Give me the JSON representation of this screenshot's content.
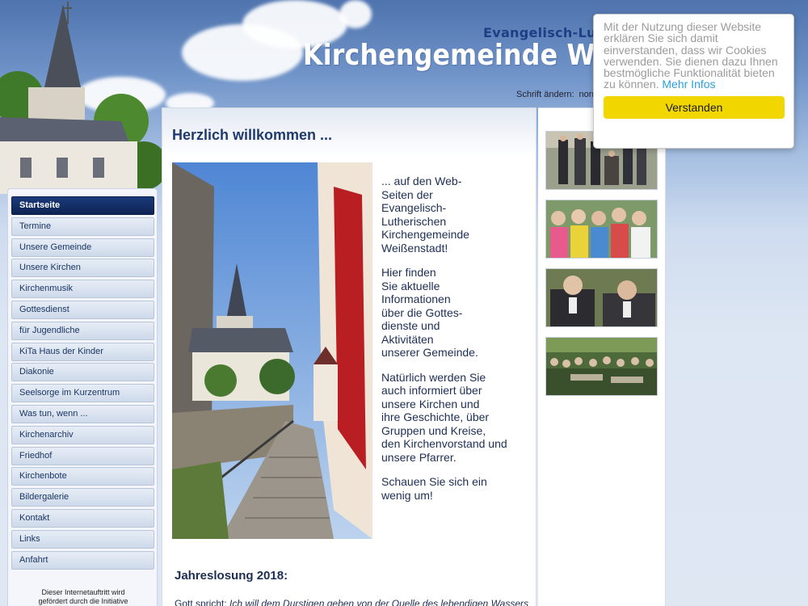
{
  "header": {
    "subtitle": "Evangelisch-Luthe",
    "title": "Kirchengemeinde Weißenst",
    "font_switch": {
      "label": "Schrift ändern:",
      "option": "norm"
    }
  },
  "nav": {
    "items": [
      "Startseite",
      "Termine",
      "Unsere Gemeinde",
      "Unsere Kirchen",
      "Kirchenmusik",
      "Gottesdienst",
      "für Jugendliche",
      "KiTa Haus der Kinder",
      "Diakonie",
      "Seelsorge im Kurzentrum",
      "Was tun, wenn ...",
      "Kirchenarchiv",
      "Friedhof",
      "Kirchenbote",
      "Bildergalerie",
      "Kontakt",
      "Links",
      "Anfahrt"
    ],
    "active": "Startseite",
    "note_line1": "Dieser Internetauftritt wird",
    "note_line2": "gefördert durch die Initiative"
  },
  "main": {
    "title": "Herzlich willkommen ...",
    "paragraphs": [
      "... auf den Web-\nSeiten der\nEvangelisch-\nLutherischen\nKirchengemeinde\nWeißenstadt!",
      "Hier finden\nSie aktuelle\nInformationen\nüber die Gottes-\ndienste und\nAktivitäten\nunserer Gemeinde.",
      "Natürlich werden Sie\nauch informiert über\nunsere Kirchen und\nihre Geschichte, über\nGruppen und Kreise,\nden Kirchenvorstand und\nunsere Pfarrer.",
      "Schauen Sie sich ein\nwenig um!"
    ],
    "jahreslosung_heading": "Jahreslosung 2018:",
    "quote_prefix": "Gott spricht:",
    "quote_text": "Ich will dem Durstigen geben von der Quelle des lebendigen Wassers"
  },
  "cookie": {
    "text": "Mit der Nutzung dieser Website erklären Sie sich damit einverstanden, dass wir Cookies verwenden. Sie dienen dazu Ihnen bestmögliche Funktionalität bieten zu können.",
    "link": "Mehr Infos",
    "button": "Verstanden",
    "button_color": "#f1d600",
    "link_color": "#2aa0dd"
  },
  "colors": {
    "nav_active": "#1b3a7a",
    "text_primary": "#1d2e54"
  }
}
